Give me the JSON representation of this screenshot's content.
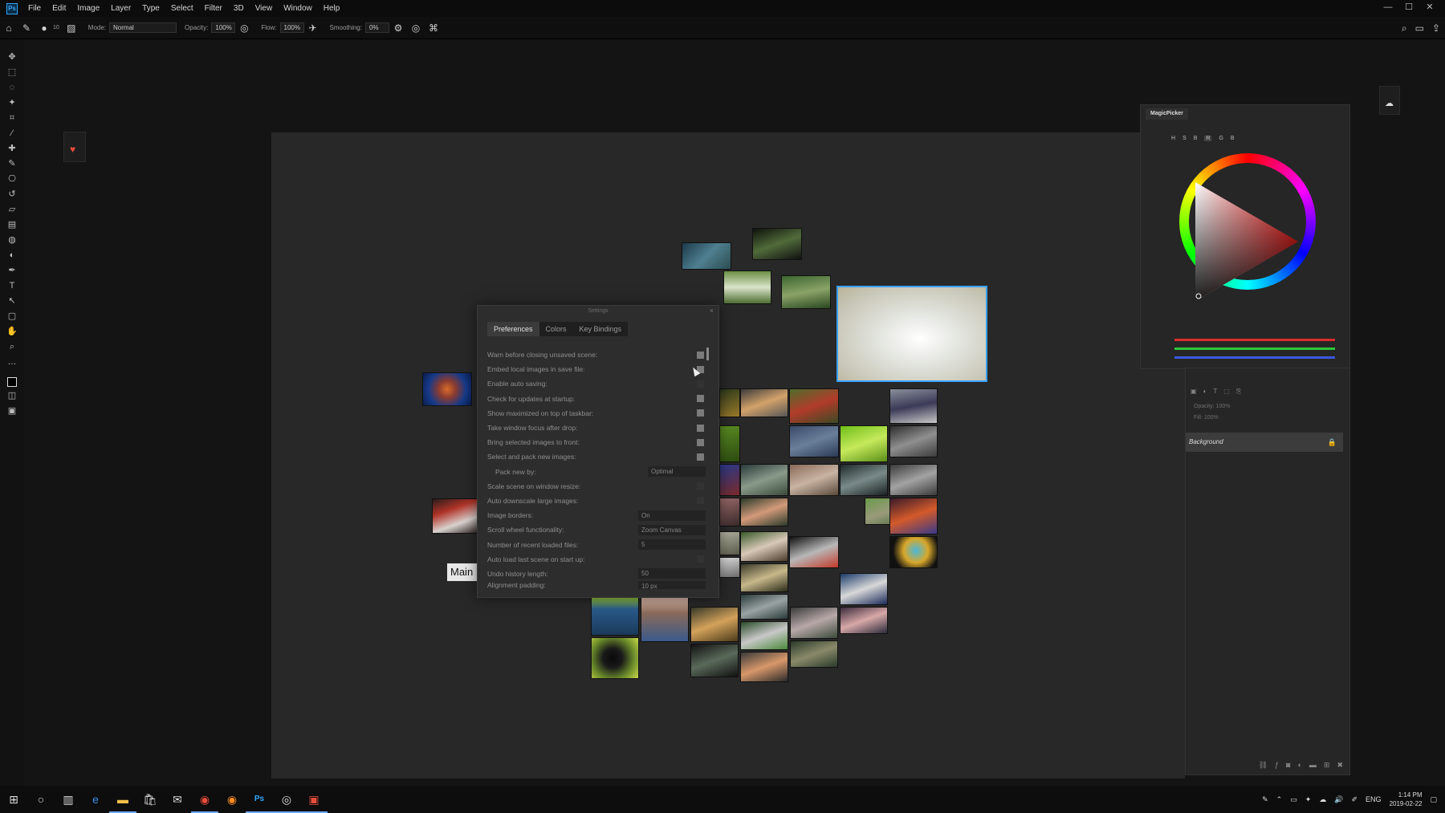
{
  "menubar": {
    "app_logo": "Ps",
    "items": [
      "File",
      "Edit",
      "Image",
      "Layer",
      "Type",
      "Select",
      "Filter",
      "3D",
      "View",
      "Window",
      "Help"
    ],
    "window_controls": [
      "—",
      "☐",
      "✕"
    ]
  },
  "options": {
    "brush_size": "10",
    "mode_label": "Mode:",
    "mode_value": "Normal",
    "opacity_label": "Opacity:",
    "opacity_value": "100%",
    "flow_label": "Flow:",
    "flow_value": "100%",
    "smoothing_label": "Smoothing:",
    "smoothing_value": "0%"
  },
  "settings": {
    "title": "Settings",
    "close": "×",
    "tabs": [
      "Preferences",
      "Colors",
      "Key Bindings"
    ],
    "active_tab": 0,
    "rows": [
      {
        "label": "Warn before closing unsaved scene:",
        "type": "check",
        "checked": true
      },
      {
        "label": "Embed local images in save file:",
        "type": "check",
        "checked": true
      },
      {
        "label": "Enable auto saving:",
        "type": "check",
        "checked": false
      },
      {
        "label": "Check for updates at startup:",
        "type": "check",
        "checked": true
      },
      {
        "label": "Show maximized on top of taskbar:",
        "type": "check",
        "checked": true
      },
      {
        "label": "Take window focus after drop:",
        "type": "check",
        "checked": true
      },
      {
        "label": "Bring selected images to front:",
        "type": "check",
        "checked": true
      },
      {
        "label": "Select and pack new images:",
        "type": "check",
        "checked": true
      },
      {
        "label": "Pack new by:",
        "type": "select",
        "value": "Optimal",
        "sub": true
      },
      {
        "label": "Scale scene on window resize:",
        "type": "check",
        "checked": false
      },
      {
        "label": "Auto downscale large images:",
        "type": "check",
        "checked": false
      },
      {
        "label": "Image borders:",
        "type": "select",
        "value": "On"
      },
      {
        "label": "Scroll wheel functionality:",
        "type": "select",
        "value": "Zoom Canvas"
      },
      {
        "label": "Number of recent loaded files:",
        "type": "spin",
        "value": "5"
      },
      {
        "label": "Auto load last scene on start up:",
        "type": "check",
        "checked": false
      },
      {
        "label": "Undo history length:",
        "type": "spin",
        "value": "50"
      },
      {
        "label": "Alignment padding:",
        "type": "spin",
        "value": "10 px"
      }
    ]
  },
  "canvas": {
    "main_label": "Main"
  },
  "magicpicker": {
    "title": "MagicPicker",
    "modes": [
      "H",
      "S",
      "B",
      "R",
      "G",
      "B"
    ],
    "active_mode": 3,
    "colors": {
      "red": "#d92b2b",
      "green": "#2ec43a",
      "blue": "#3a58e0"
    }
  },
  "layers": {
    "opacity_label": "Opacity:",
    "opacity_value": "100%",
    "fill_label": "Fill:",
    "fill_value": "100%",
    "layer_name": "Background"
  },
  "taskbar": {
    "apps": [
      "start-icon",
      "cortana-icon",
      "task-view-icon",
      "edge-icon",
      "explorer-icon",
      "store-icon",
      "mail-icon",
      "chrome-icon",
      "firefox-icon",
      "photoshop-icon",
      "obs-icon",
      "purref-icon"
    ],
    "lang": "ENG",
    "time": "1:14 PM",
    "date": "2019-02-22"
  }
}
